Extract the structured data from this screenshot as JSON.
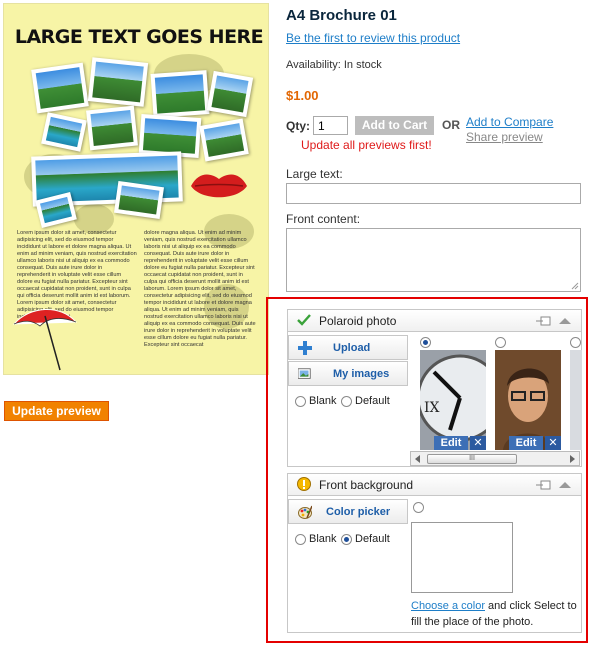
{
  "preview": {
    "headline": "LARGE TEXT GOES HERE",
    "lorem_left": "Lorem ipsum dolor sit amet, consectetur adipisicing elit, sed do eiusmod tempor incididunt ut labore et dolore magna aliqua. Ut enim ad minim veniam, quis nostrud exercitation ullamco laboris nisi ut aliquip ex ea commodo consequat. Duis aute irure dolor in reprehenderit in voluptate velit esse cillum dolore eu fugiat nulla pariatur. Excepteur sint occaecat cupidatat non proident, sunt in culpa qui officia deserunt mollit anim id est laborum. Lorem ipsum dolor sit amet, consectetur adipisicing elit, sed do eiusmod tempor incididunt ut labore et",
    "lorem_right": "dolore magna aliqua. Ut enim ad minim veniam, quis nostrud exercitation ullamco laboris nisi ut aliquip ex ea commodo consequat. Duis aute irure dolor in reprehenderit in voluptate velit esse cillum dolore eu fugiat nulla pariatur. Excepteur sint occaecat cupidatat non proident, sunt in culpa qui officia deserunt mollit anim id est laborum. Lorem ipsum dolor sit amet, consectetur adipisicing elit, sed do eiusmod tempor incididunt ut labore et dolore magna aliqua. Ut enim ad minim veniam, quis nostrud exercitation ullamco laboris nisi ut aliquip ex ea commodo consequat. Duis aute irure dolor in reprehenderit in voluptate velit esse cillum dolore eu fugiat nulla pariatur. Excepteur sint occaecat",
    "update_button": "Update preview"
  },
  "product": {
    "title": "A4 Brochure 01",
    "review_link": "Be the first to review this product",
    "availability": "Availability: In stock",
    "price": "$1.00",
    "qty_label": "Qty:",
    "qty_value": "1",
    "add_to_cart": "Add to Cart",
    "or": "OR",
    "add_to_compare": "Add to Compare",
    "share_preview": "Share preview",
    "warning": "Update all previews first!",
    "large_text_label": "Large text:",
    "front_content_label": "Front content:"
  },
  "editor": {
    "photo_panel": {
      "title": "Polaroid photo",
      "upload_label": "Upload",
      "my_images_label": "My images",
      "blank_label": "Blank",
      "default_label": "Default",
      "edit_label": "Edit",
      "delete_label": "✕",
      "scroll_grip": "III"
    },
    "background_panel": {
      "title": "Front background",
      "color_picker_label": "Color picker",
      "blank_label": "Blank",
      "default_label": "Default",
      "choose_link": "Choose a color",
      "choose_text": " and click Select to fill the place of the photo."
    }
  },
  "colors": {
    "accent_orange": "#f18200",
    "link_blue": "#1e7ec8",
    "warning_red": "#df1a1a",
    "highlight_border": "#e40000",
    "price_orange": "#e26703"
  },
  "icons": {
    "photo_panel_header": "check-icon",
    "upload": "plus-icon",
    "my_images": "images-icon",
    "background_panel_header": "warning-icon",
    "color_picker": "palette-icon",
    "panel_controls": "window-collapse-icon"
  }
}
